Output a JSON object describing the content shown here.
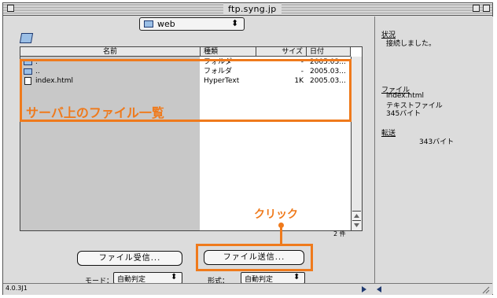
{
  "window": {
    "title": "ftp.syng.jp"
  },
  "location": {
    "folder": "web",
    "arrows": "⬍"
  },
  "table": {
    "headers": [
      "名前",
      "種類",
      "サイズ",
      "日付"
    ],
    "rows": [
      {
        "name": ".",
        "kind": "フォルダ",
        "size": "-",
        "date": "2005.03..."
      },
      {
        "name": "..",
        "kind": "フォルダ",
        "size": "-",
        "date": "2005.03..."
      },
      {
        "name": "index.html",
        "kind": "HyperText",
        "size": "1K",
        "date": "2005.03..."
      }
    ],
    "count": "2 件"
  },
  "annotations": {
    "list_label": "サーバ上のファイル一覧",
    "click_label": "クリック"
  },
  "buttons": {
    "receive": "ファイル受信...",
    "send": "ファイル送信..."
  },
  "mode": {
    "label": "モード：",
    "value": "自動判定",
    "format_label": "形式：",
    "format_value": "自動判定"
  },
  "status": {
    "version": "4.0.3J1",
    "status_head": "状況",
    "status_text": "接続しました。",
    "file_head": "ファイル",
    "file_name": "index.html",
    "file_type": "テキストファイル",
    "file_size": "345バイト",
    "transfer_head": "転送",
    "transfer_text": "343バイト"
  },
  "colors": {
    "accent": "#ef7a1c"
  }
}
